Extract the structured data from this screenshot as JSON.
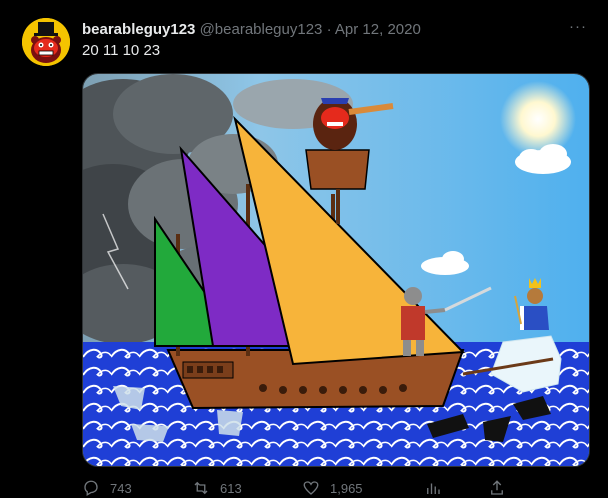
{
  "tweet": {
    "author_name": "bearableguy123",
    "handle": "@bearableguy123",
    "separator": "·",
    "date": "Apr 12, 2020",
    "text": "20 11 10 23",
    "more_label": "···",
    "image_alt": "Illustration of a sailing ship with green, purple and orange sails on stormy blue waves, a bear lookout with a spyglass in the crow's nest, a knight with a sword on deck, and a king on an iceberg"
  },
  "actions": {
    "replies": "743",
    "retweets": "613",
    "likes": "1,965"
  },
  "colors": {
    "background": "#000000",
    "text_primary": "#e7e9ea",
    "text_secondary": "#71767b",
    "border": "#2f3336",
    "sail_green": "#22a93b",
    "sail_purple": "#7e2bc5",
    "sail_orange": "#f7b43a",
    "sea_blue": "#1f3fd6",
    "sky_blue": "#5ab6ee"
  }
}
